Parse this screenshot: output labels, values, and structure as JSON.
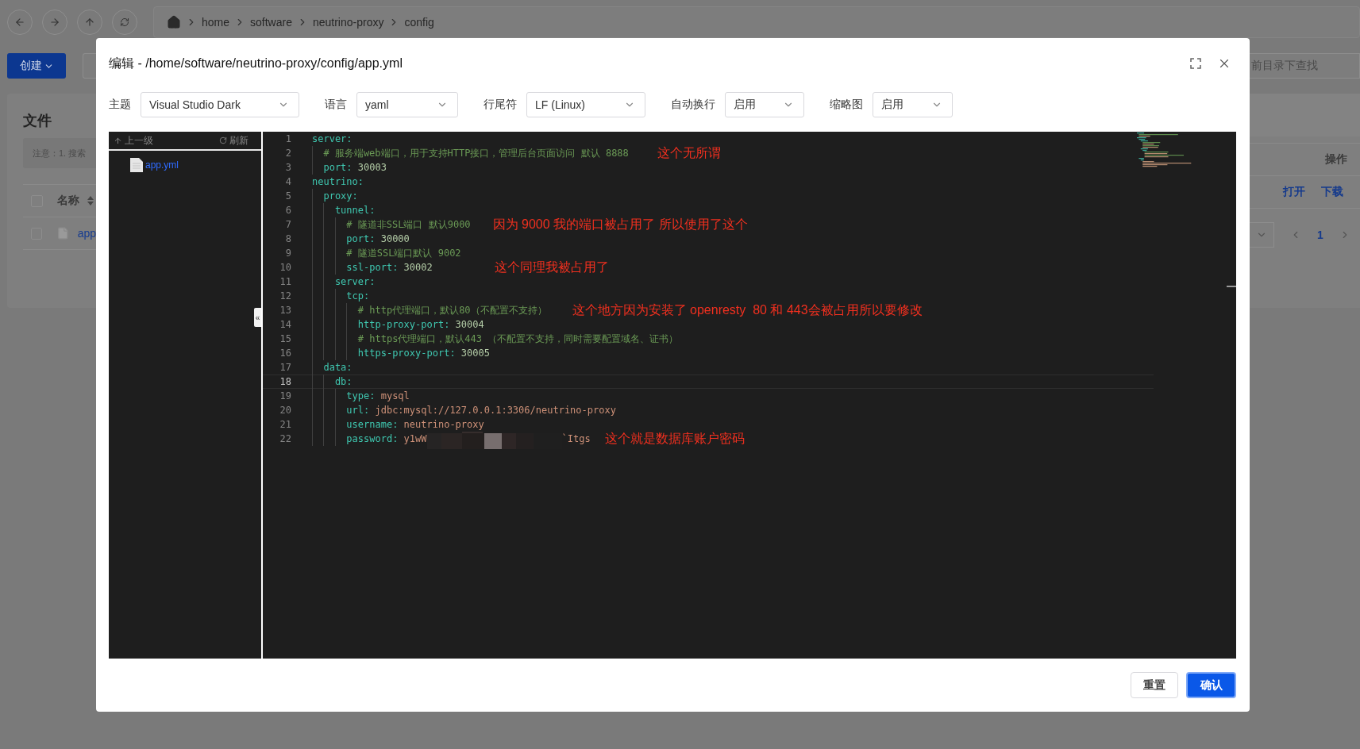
{
  "breadcrumb": [
    "home",
    "software",
    "neutrino-proxy",
    "config"
  ],
  "background": {
    "create_button": "创建",
    "title": "文件",
    "notice": "注意：1. 搜索",
    "select_all_checked": false,
    "columns": [
      "名称",
      "操作"
    ],
    "rows": [
      {
        "name": "app",
        "checked": false,
        "actions": [
          "打开",
          "下载"
        ]
      }
    ],
    "search_placeholder": "前目录下查找",
    "page": "1"
  },
  "dialog": {
    "title": "编辑 - /home/software/neutrino-proxy/config/app.yml",
    "options": [
      {
        "label": "主题",
        "value": "Visual Studio Dark"
      },
      {
        "label": "语言",
        "value": "yaml"
      },
      {
        "label": "行尾符",
        "value": "LF (Linux)"
      },
      {
        "label": "自动换行",
        "value": "启用"
      },
      {
        "label": "缩略图",
        "value": "启用"
      }
    ],
    "file_tree": {
      "up": "上一级",
      "refresh": "刷新",
      "collapse": "«",
      "files": [
        {
          "name": "app.yml",
          "selected": true
        }
      ]
    },
    "editor": {
      "lines": [
        {
          "n": "1",
          "kind": "section",
          "key": "server:",
          "active": false
        },
        {
          "n": "2",
          "kind": "comment",
          "text": "  # 服务端web端口，用于支持HTTP接口，管理后台页面访问 默认 8888",
          "note": "这个无所谓",
          "active": false
        },
        {
          "n": "3",
          "kind": "number",
          "key": "  port:",
          "value": "30003",
          "active": false
        },
        {
          "n": "4",
          "kind": "section",
          "key": "neutrino:",
          "active": false
        },
        {
          "n": "5",
          "kind": "section",
          "key": "  proxy:",
          "active": false
        },
        {
          "n": "6",
          "kind": "section",
          "key": "    tunnel:",
          "active": false
        },
        {
          "n": "7",
          "kind": "comment",
          "text": "      # 隧道非SSL端口 默认9000",
          "note": "因为 9000 我的端口被占用了 所以使用了这个",
          "active": false
        },
        {
          "n": "8",
          "kind": "number",
          "key": "      port:",
          "value": "30000",
          "active": false
        },
        {
          "n": "9",
          "kind": "comment",
          "text": "      # 隧道SSL端口默认 9002",
          "active": false
        },
        {
          "n": "10",
          "kind": "number",
          "key": "      ssl-port:",
          "value": "30002",
          "note": "这个同理我被占用了",
          "active": false
        },
        {
          "n": "11",
          "kind": "section",
          "key": "    server:",
          "active": false
        },
        {
          "n": "12",
          "kind": "section",
          "key": "      tcp:",
          "active": false
        },
        {
          "n": "13",
          "kind": "comment",
          "text": "        # http代理端口，默认80（不配置不支持）",
          "note": "这个地方因为安装了 openresty  80 和 443会被占用所以要修改",
          "active": false
        },
        {
          "n": "14",
          "kind": "number",
          "key": "        http-proxy-port:",
          "value": "30004",
          "active": false
        },
        {
          "n": "15",
          "kind": "comment",
          "text": "        # https代理端口，默认443 （不配置不支持，同时需要配置域名、证书）",
          "active": false
        },
        {
          "n": "16",
          "kind": "number",
          "key": "        https-proxy-port:",
          "value": "30005",
          "active": false
        },
        {
          "n": "17",
          "kind": "section",
          "key": "  data:",
          "active": false
        },
        {
          "n": "18",
          "kind": "section",
          "key": "    db:",
          "active": true
        },
        {
          "n": "19",
          "kind": "string",
          "key": "      type:",
          "value": "mysql",
          "active": false
        },
        {
          "n": "20",
          "kind": "string",
          "key": "      url:",
          "value": "jdbc:mysql://127.0.0.1:3306/neutrino-proxy",
          "active": false
        },
        {
          "n": "21",
          "kind": "string",
          "key": "      username:",
          "value": "neutrino-proxy",
          "active": false
        },
        {
          "n": "22",
          "kind": "secret",
          "key": "      password:",
          "value": "y1wW",
          "value_end": "`Itgs",
          "note": "这个就是数据库账户密码",
          "active": false
        }
      ]
    },
    "buttons": [
      {
        "label": "重置",
        "kind": "default"
      },
      {
        "label": "确认",
        "kind": "primary"
      }
    ]
  }
}
